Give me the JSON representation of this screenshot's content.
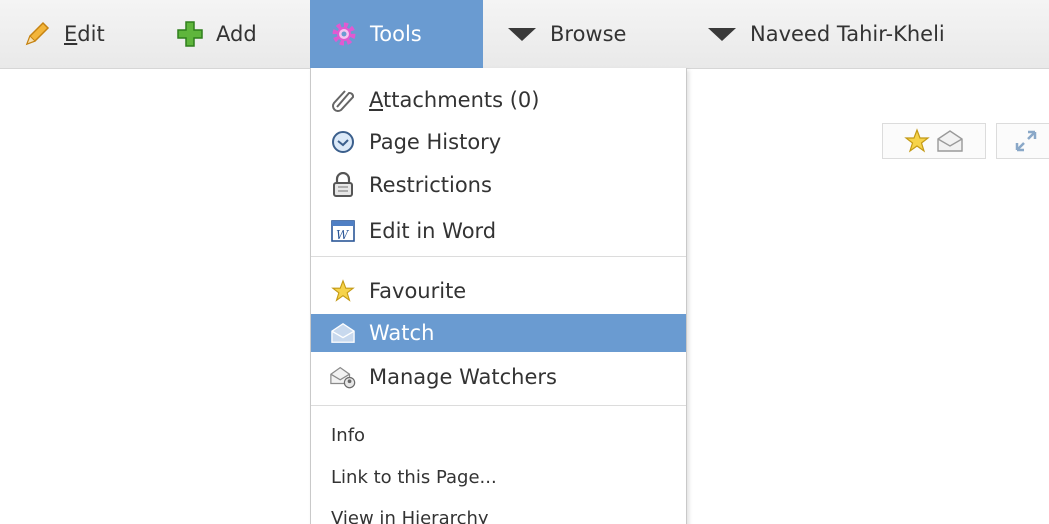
{
  "menubar": {
    "edit_label": "Edit",
    "add_label": "Add",
    "tools_label": "Tools",
    "browse_label": "Browse",
    "user_label": "Naveed Tahir-Kheli"
  },
  "tools_menu": {
    "items": [
      {
        "label": "Attachments (0)",
        "icon": "paperclip-icon"
      },
      {
        "label": "Page History",
        "icon": "clock-icon"
      },
      {
        "label": "Restrictions",
        "icon": "lock-icon"
      },
      {
        "label": "Edit in Word",
        "icon": "word-icon"
      },
      {
        "label": "Favourite",
        "icon": "star-icon"
      },
      {
        "label": "Watch",
        "icon": "envelope-icon"
      },
      {
        "label": "Manage Watchers",
        "icon": "watchers-icon"
      },
      {
        "label": "Info"
      },
      {
        "label": "Link to this Page..."
      },
      {
        "label": "View in Hierarchy"
      }
    ],
    "active_item": "Watch"
  },
  "colors": {
    "active_bg": "#6a9bd1",
    "menubar_bg": "#eeeeee",
    "text": "#333333"
  }
}
